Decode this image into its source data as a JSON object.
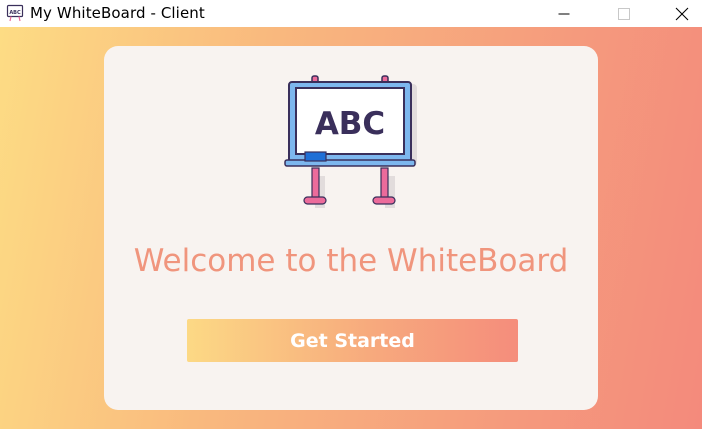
{
  "window": {
    "title": "My WhiteBoard - Client",
    "app_icon": "whiteboard-icon",
    "controls": [
      "minimize-icon",
      "maximize-icon",
      "close-icon"
    ]
  },
  "card": {
    "illustration": {
      "icon": "whiteboard-easel-icon",
      "board_text": "ABC"
    },
    "welcome_text": "Welcome to the WhiteBoard",
    "button_label": "Get Started"
  },
  "colors": {
    "gradient_start": "#fddc84",
    "gradient_end": "#f48a7c",
    "card_background": "#f8f3f0",
    "welcome_text": "#f0957d",
    "button_text": "#ffffff",
    "board_text": "#3a2f5b",
    "board_frame": "#3a2f5b",
    "board_legs": "#ec6b9b",
    "eraser": "#1f6fd6"
  }
}
